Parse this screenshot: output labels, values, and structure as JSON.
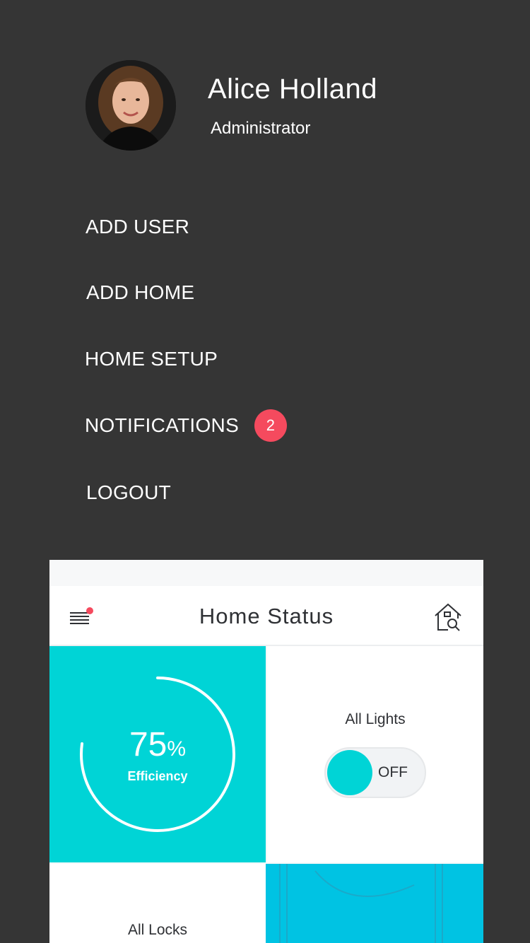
{
  "user": {
    "name": "Alice Holland",
    "role": "Administrator"
  },
  "menu": {
    "items": [
      {
        "label": "ADD USER"
      },
      {
        "label": "ADD HOME"
      },
      {
        "label": "HOME SETUP"
      },
      {
        "label": "NOTIFICATIONS",
        "badge": "2"
      },
      {
        "label": "LOGOUT"
      }
    ]
  },
  "preview": {
    "title": "Home Status",
    "menu_icon": "hamburger-menu-icon",
    "home_icon": "home-search-icon",
    "efficiency": {
      "value": "75",
      "unit": "%",
      "label": "Efficiency",
      "fraction": 0.75
    },
    "lights": {
      "label": "All Lights",
      "state": "OFF"
    },
    "locks": {
      "label": "All Locks"
    }
  },
  "colors": {
    "background": "#353535",
    "accent": "#00d4d6",
    "badge": "#f54a5e",
    "tile_blue": "#00c3e3"
  }
}
